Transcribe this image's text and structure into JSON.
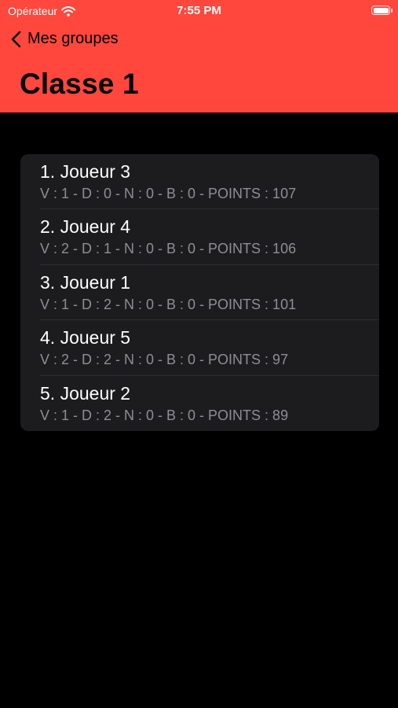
{
  "status_bar": {
    "carrier": "Opérateur",
    "time": "7:55 PM"
  },
  "navigation": {
    "back_label": "Mes groupes",
    "title": "Classe 1"
  },
  "colors": {
    "header_background": "#ff473d",
    "page_background": "#000000",
    "list_background": "#1c1c1e",
    "primary_text": "#ffffff",
    "secondary_text": "#8e8e93"
  },
  "ranking": [
    {
      "title": "1. Joueur 3",
      "stats": "V : 1 - D : 0 - N : 0 - B : 0 - POINTS : 107"
    },
    {
      "title": "2. Joueur 4",
      "stats": "V : 2 - D : 1 - N : 0 - B : 0 - POINTS : 106"
    },
    {
      "title": "3. Joueur 1",
      "stats": "V : 1 - D : 2 - N : 0 - B : 0 - POINTS : 101"
    },
    {
      "title": "4. Joueur 5",
      "stats": "V : 2 - D : 2 - N : 0 - B : 0 - POINTS : 97"
    },
    {
      "title": "5. Joueur 2",
      "stats": "V : 1 - D : 2 - N : 0 - B : 0 - POINTS : 89"
    }
  ]
}
